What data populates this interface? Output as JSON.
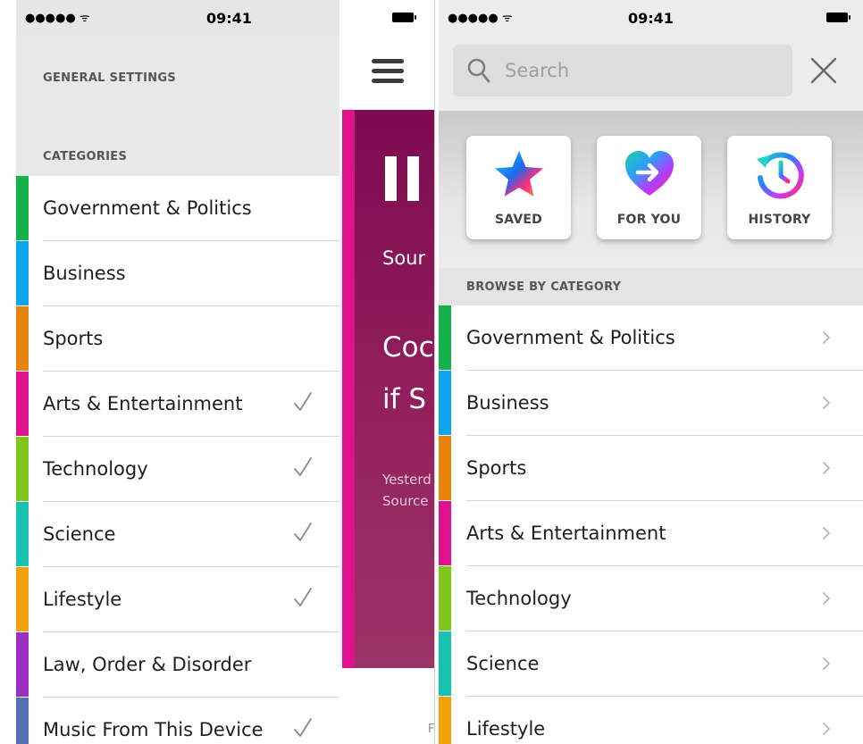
{
  "status_bar": {
    "signal": "●●●●● ᯤ",
    "time": "09:41",
    "battery_icon": "battery-full-icon"
  },
  "settings": {
    "general_title": "GENERAL SETTINGS",
    "categories_title": "CATEGORIES",
    "items": [
      {
        "label": "Government & Politics",
        "color": "#14b34a",
        "checked": false
      },
      {
        "label": "Business",
        "color": "#0ea5ef",
        "checked": false
      },
      {
        "label": "Sports",
        "color": "#e8840c",
        "checked": false
      },
      {
        "label": "Arts & Entertainment",
        "color": "#e0118c",
        "checked": true
      },
      {
        "label": "Technology",
        "color": "#7fc61c",
        "checked": true
      },
      {
        "label": "Science",
        "color": "#17c3b0",
        "checked": true
      },
      {
        "label": "Lifestyle",
        "color": "#f4a10b",
        "checked": true
      },
      {
        "label": "Law, Order & Disorder",
        "color": "#9a2fc0",
        "checked": false
      },
      {
        "label": "Music From This Device",
        "color": "#5470b0",
        "checked": true
      }
    ]
  },
  "article": {
    "menu_icon": "hamburger-icon",
    "play_state_icon": "pause-icon",
    "source_partial": "Sour",
    "title_line1_partial": "Coc",
    "title_line2_partial": "if S",
    "meta_line1_partial": "Yesterd",
    "meta_line2_partial": "Source",
    "footer_partial": "F",
    "accent_color": "#e0118c"
  },
  "browse": {
    "search": {
      "placeholder": "Search",
      "value": "",
      "icon": "search-icon",
      "close_icon": "close-icon"
    },
    "shortcuts": [
      {
        "label": "SAVED",
        "icon": "star-icon"
      },
      {
        "label": "FOR YOU",
        "icon": "heart-arrow-icon"
      },
      {
        "label": "HISTORY",
        "icon": "history-clock-icon"
      }
    ],
    "section_title": "BROWSE BY CATEGORY",
    "items": [
      {
        "label": "Government & Politics",
        "color": "#14b34a"
      },
      {
        "label": "Business",
        "color": "#0ea5ef"
      },
      {
        "label": "Sports",
        "color": "#e8840c"
      },
      {
        "label": "Arts & Entertainment",
        "color": "#e0118c"
      },
      {
        "label": "Technology",
        "color": "#7fc61c"
      },
      {
        "label": "Science",
        "color": "#17c3b0"
      },
      {
        "label": "Lifestyle",
        "color": "#f4a10b"
      }
    ]
  }
}
